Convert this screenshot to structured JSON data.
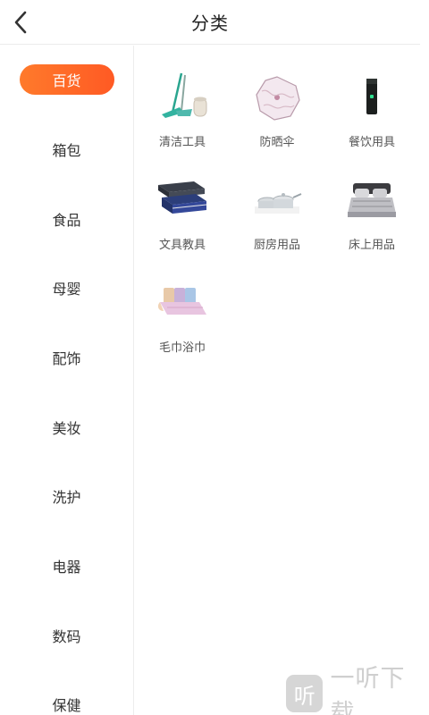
{
  "header": {
    "title": "分类"
  },
  "sidebar": {
    "items": [
      {
        "label": "百货",
        "active": true
      },
      {
        "label": "箱包"
      },
      {
        "label": "食品"
      },
      {
        "label": "母婴"
      },
      {
        "label": "配饰"
      },
      {
        "label": "美妆"
      },
      {
        "label": "洗护"
      },
      {
        "label": "电器"
      },
      {
        "label": "数码"
      },
      {
        "label": "保健"
      }
    ]
  },
  "main": {
    "items": [
      {
        "label": "清洁工具",
        "icon": "mop-bucket-icon"
      },
      {
        "label": "防晒伞",
        "icon": "umbrella-icon"
      },
      {
        "label": "餐饮用具",
        "icon": "thermos-icon"
      },
      {
        "label": "文具教具",
        "icon": "pencil-case-icon"
      },
      {
        "label": "厨房用品",
        "icon": "cookware-icon"
      },
      {
        "label": "床上用品",
        "icon": "bedding-icon"
      },
      {
        "label": "毛巾浴巾",
        "icon": "towel-icon"
      }
    ]
  },
  "watermark": {
    "text": "一听下载",
    "logo_char": "听"
  },
  "colors": {
    "accent": "#ff6a28",
    "divider": "#ececec"
  }
}
